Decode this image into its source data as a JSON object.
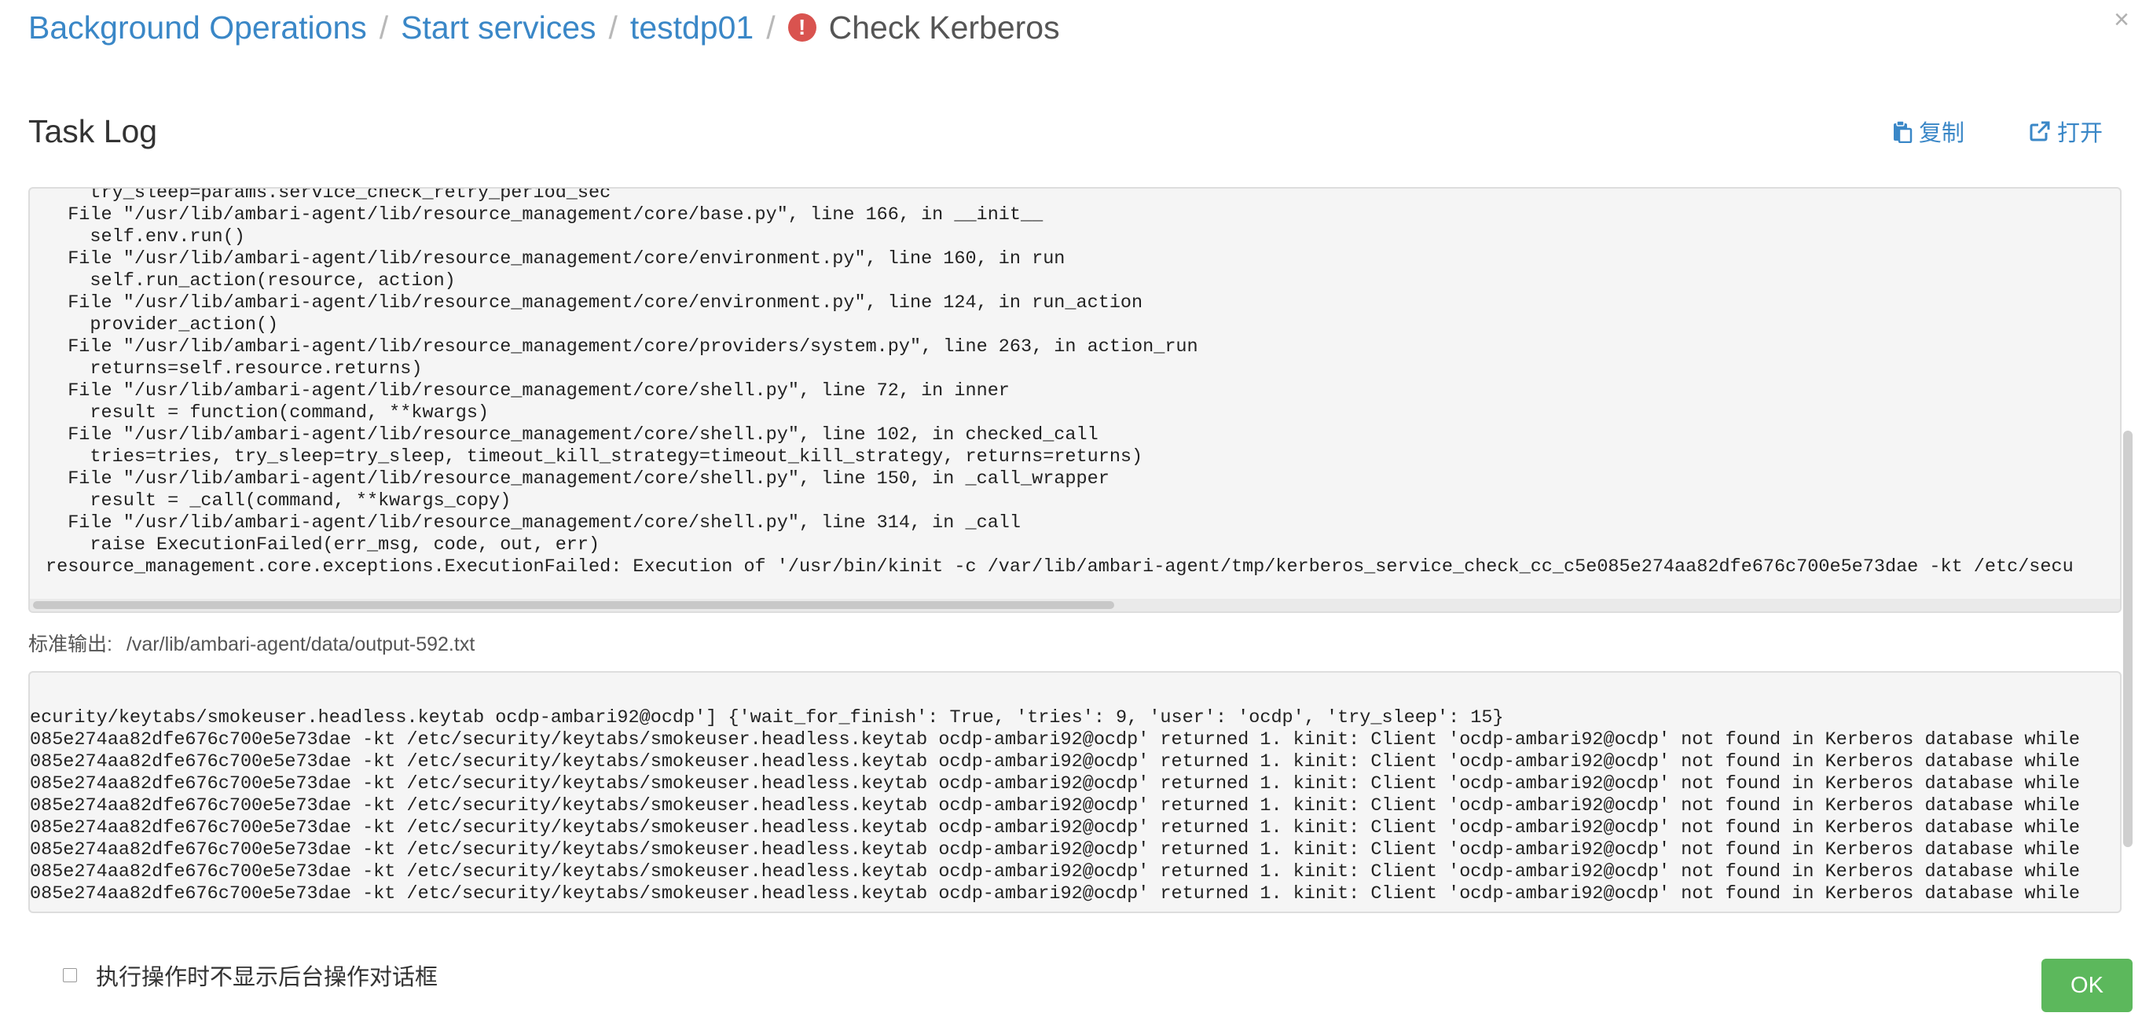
{
  "breadcrumb": {
    "items": [
      "Background Operations",
      "Start services",
      "testdp01"
    ],
    "separator": "/",
    "current": "Check Kerberos",
    "alert_glyph": "!"
  },
  "close_glyph": "×",
  "task_log": {
    "title": "Task Log",
    "copy_label": "复制",
    "open_label": "打开"
  },
  "stderr_log": {
    "lines": [
      "    try_sleep=params.service_check_retry_period_sec",
      "  File \"/usr/lib/ambari-agent/lib/resource_management/core/base.py\", line 166, in __init__",
      "    self.env.run()",
      "  File \"/usr/lib/ambari-agent/lib/resource_management/core/environment.py\", line 160, in run",
      "    self.run_action(resource, action)",
      "  File \"/usr/lib/ambari-agent/lib/resource_management/core/environment.py\", line 124, in run_action",
      "    provider_action()",
      "  File \"/usr/lib/ambari-agent/lib/resource_management/core/providers/system.py\", line 263, in action_run",
      "    returns=self.resource.returns)",
      "  File \"/usr/lib/ambari-agent/lib/resource_management/core/shell.py\", line 72, in inner",
      "    result = function(command, **kwargs)",
      "  File \"/usr/lib/ambari-agent/lib/resource_management/core/shell.py\", line 102, in checked_call",
      "    tries=tries, try_sleep=try_sleep, timeout_kill_strategy=timeout_kill_strategy, returns=returns)",
      "  File \"/usr/lib/ambari-agent/lib/resource_management/core/shell.py\", line 150, in _call_wrapper",
      "    result = _call(command, **kwargs_copy)",
      "  File \"/usr/lib/ambari-agent/lib/resource_management/core/shell.py\", line 314, in _call",
      "    raise ExecutionFailed(err_msg, code, out, err)",
      "resource_management.core.exceptions.ExecutionFailed: Execution of '/usr/bin/kinit -c /var/lib/ambari-agent/tmp/kerberos_service_check_cc_c5e085e274aa82dfe676c700e5e73dae -kt /etc/secu"
    ]
  },
  "stdout": {
    "label": "标准输出:",
    "path": "/var/lib/ambari-agent/data/output-592.txt",
    "lines": [
      "ecurity/keytabs/smokeuser.headless.keytab ocdp-ambari92@ocdp'] {'wait_for_finish': True, 'tries': 9, 'user': 'ocdp', 'try_sleep': 15}",
      "085e274aa82dfe676c700e5e73dae -kt /etc/security/keytabs/smokeuser.headless.keytab ocdp-ambari92@ocdp' returned 1. kinit: Client 'ocdp-ambari92@ocdp' not found in Kerberos database while",
      "085e274aa82dfe676c700e5e73dae -kt /etc/security/keytabs/smokeuser.headless.keytab ocdp-ambari92@ocdp' returned 1. kinit: Client 'ocdp-ambari92@ocdp' not found in Kerberos database while",
      "085e274aa82dfe676c700e5e73dae -kt /etc/security/keytabs/smokeuser.headless.keytab ocdp-ambari92@ocdp' returned 1. kinit: Client 'ocdp-ambari92@ocdp' not found in Kerberos database while",
      "085e274aa82dfe676c700e5e73dae -kt /etc/security/keytabs/smokeuser.headless.keytab ocdp-ambari92@ocdp' returned 1. kinit: Client 'ocdp-ambari92@ocdp' not found in Kerberos database while",
      "085e274aa82dfe676c700e5e73dae -kt /etc/security/keytabs/smokeuser.headless.keytab ocdp-ambari92@ocdp' returned 1. kinit: Client 'ocdp-ambari92@ocdp' not found in Kerberos database while",
      "085e274aa82dfe676c700e5e73dae -kt /etc/security/keytabs/smokeuser.headless.keytab ocdp-ambari92@ocdp' returned 1. kinit: Client 'ocdp-ambari92@ocdp' not found in Kerberos database while",
      "085e274aa82dfe676c700e5e73dae -kt /etc/security/keytabs/smokeuser.headless.keytab ocdp-ambari92@ocdp' returned 1. kinit: Client 'ocdp-ambari92@ocdp' not found in Kerberos database while",
      "085e274aa82dfe676c700e5e73dae -kt /etc/security/keytabs/smokeuser.headless.keytab ocdp-ambari92@ocdp' returned 1. kinit: Client 'ocdp-ambari92@ocdp' not found in Kerberos database while"
    ]
  },
  "footer": {
    "suppress_label": "执行操作时不显示后台操作对话框",
    "suppress_checked": false,
    "ok_label": "OK"
  },
  "colors": {
    "link": "#3a87c7",
    "alert": "#d9534f",
    "ok_button": "#5cb85c",
    "log_background": "#f5f5f5"
  },
  "icons": {
    "alert": "exclamation-circle-icon",
    "close": "close-icon",
    "copy": "clipboard-icon",
    "open": "external-link-icon"
  }
}
